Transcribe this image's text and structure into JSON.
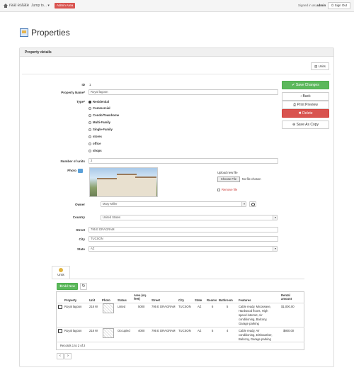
{
  "topbar": {
    "brand": "real estate",
    "jump_to": "Jump to...",
    "admin_area": "Admin Area",
    "signed_in_prefix": "Signed in as",
    "user": "admin",
    "sign_out": "Sign Out"
  },
  "page": {
    "title": "Properties"
  },
  "panel": {
    "heading": "Property details",
    "units_button": "Units"
  },
  "form": {
    "id_label": "ID",
    "id_value": "1",
    "name_label": "Property Name*",
    "name_value": "Royal lagoon",
    "type_label": "Type*",
    "type_options": [
      "Residential",
      "Commercial",
      "Condo/Townhome",
      "Multi-Family",
      "Single-Family",
      "stores",
      "office",
      "shops"
    ],
    "type_selected": "Residential",
    "units_label": "Number of units",
    "units_value": "2",
    "photo_label": "Photo",
    "upload_label": "Upload new file",
    "choose_file": "Choose File",
    "no_file": "No file chosen",
    "remove_file": "Remove file",
    "owner_label": "Owner",
    "owner_value": "Mary Miller",
    "country_label": "Country",
    "country_value": "United States",
    "street_label": "Street",
    "street_value": "795 E DRAGRAM",
    "city_label": "City",
    "city_value": "TUCSON",
    "state_label": "State",
    "state_value": "AZ"
  },
  "actions": {
    "save": "Save Changes",
    "back": "Back",
    "print": "Print Preview",
    "delete": "Delete",
    "save_as_copy": "Save As Copy"
  },
  "units_tab": {
    "tab_label": "Units",
    "add_new": "Add New",
    "columns": [
      "Property",
      "Unit",
      "Photo",
      "Status",
      "Area (sq. feet)",
      "Street",
      "City",
      "State",
      "Rooms",
      "Bathroom",
      "Features",
      "Rental amount"
    ],
    "rows": [
      {
        "property": "Royal lagoon",
        "unit": "218 W",
        "status": "Listed",
        "area": "5000",
        "street": "795 E DRAGRAM",
        "city": "TUCSON",
        "state": "AZ",
        "rooms": "6",
        "bathroom": "5",
        "features": [
          "Cable ready, Micorwave,",
          "Hardwood floors, High",
          "speed internet, Air",
          "conditioning, Balcony,",
          "Garage parking"
        ],
        "rent": "$1,000.00"
      },
      {
        "property": "Royal lagoon",
        "unit": "218 W",
        "status": "Occupied",
        "area": "4000",
        "street": "795 E DRAGRAM",
        "city": "TUCSON",
        "state": "AZ",
        "rooms": "5",
        "bathroom": "4",
        "features": [
          "Cable ready, Air",
          "conditioning, Dishwasher,",
          "Balcony, Garage parking"
        ],
        "rent": "$800.00"
      }
    ],
    "records": "Records 1 to 2 of 2",
    "prev": "‹",
    "next": "›"
  }
}
